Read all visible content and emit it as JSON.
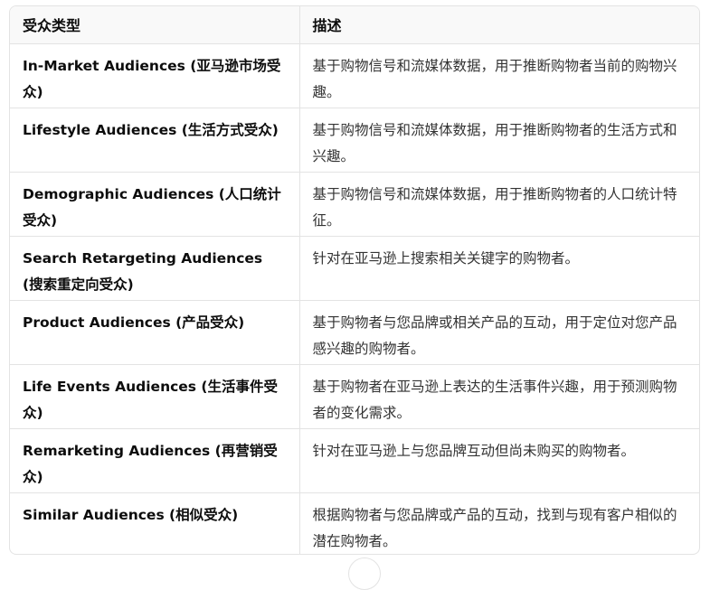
{
  "table": {
    "headers": [
      "受众类型",
      "描述"
    ],
    "rows": [
      {
        "type": "In-Market Audiences (亚马逊市场受众)",
        "desc": "基于购物信号和流媒体数据，用于推断购物者当前的购物兴趣。"
      },
      {
        "type": "Lifestyle Audiences (生活方式受众)",
        "desc": "基于购物信号和流媒体数据，用于推断购物者的生活方式和兴趣。"
      },
      {
        "type": "Demographic Audiences (人口统计受众)",
        "desc": "基于购物信号和流媒体数据，用于推断购物者的人口统计特征。"
      },
      {
        "type": "Search Retargeting Audiences (搜索重定向受众)",
        "desc": "针对在亚马逊上搜索相关关键字的购物者。"
      },
      {
        "type": "Product Audiences (产品受众)",
        "desc": "基于购物者与您品牌或相关产品的互动，用于定位对您产品感兴趣的购物者。"
      },
      {
        "type": "Life Events Audiences (生活事件受众)",
        "desc": "基于购物者在亚马逊上表达的生活事件兴趣，用于预测购物者的变化需求。"
      },
      {
        "type": "Remarketing Audiences (再营销受众)",
        "desc": "针对在亚马逊上与您品牌互动但尚未购买的购物者。"
      },
      {
        "type": "Similar Audiences (相似受众)",
        "desc": "根据购物者与您品牌或产品的互动，找到与现有客户相似的潜在购物者。"
      }
    ]
  }
}
